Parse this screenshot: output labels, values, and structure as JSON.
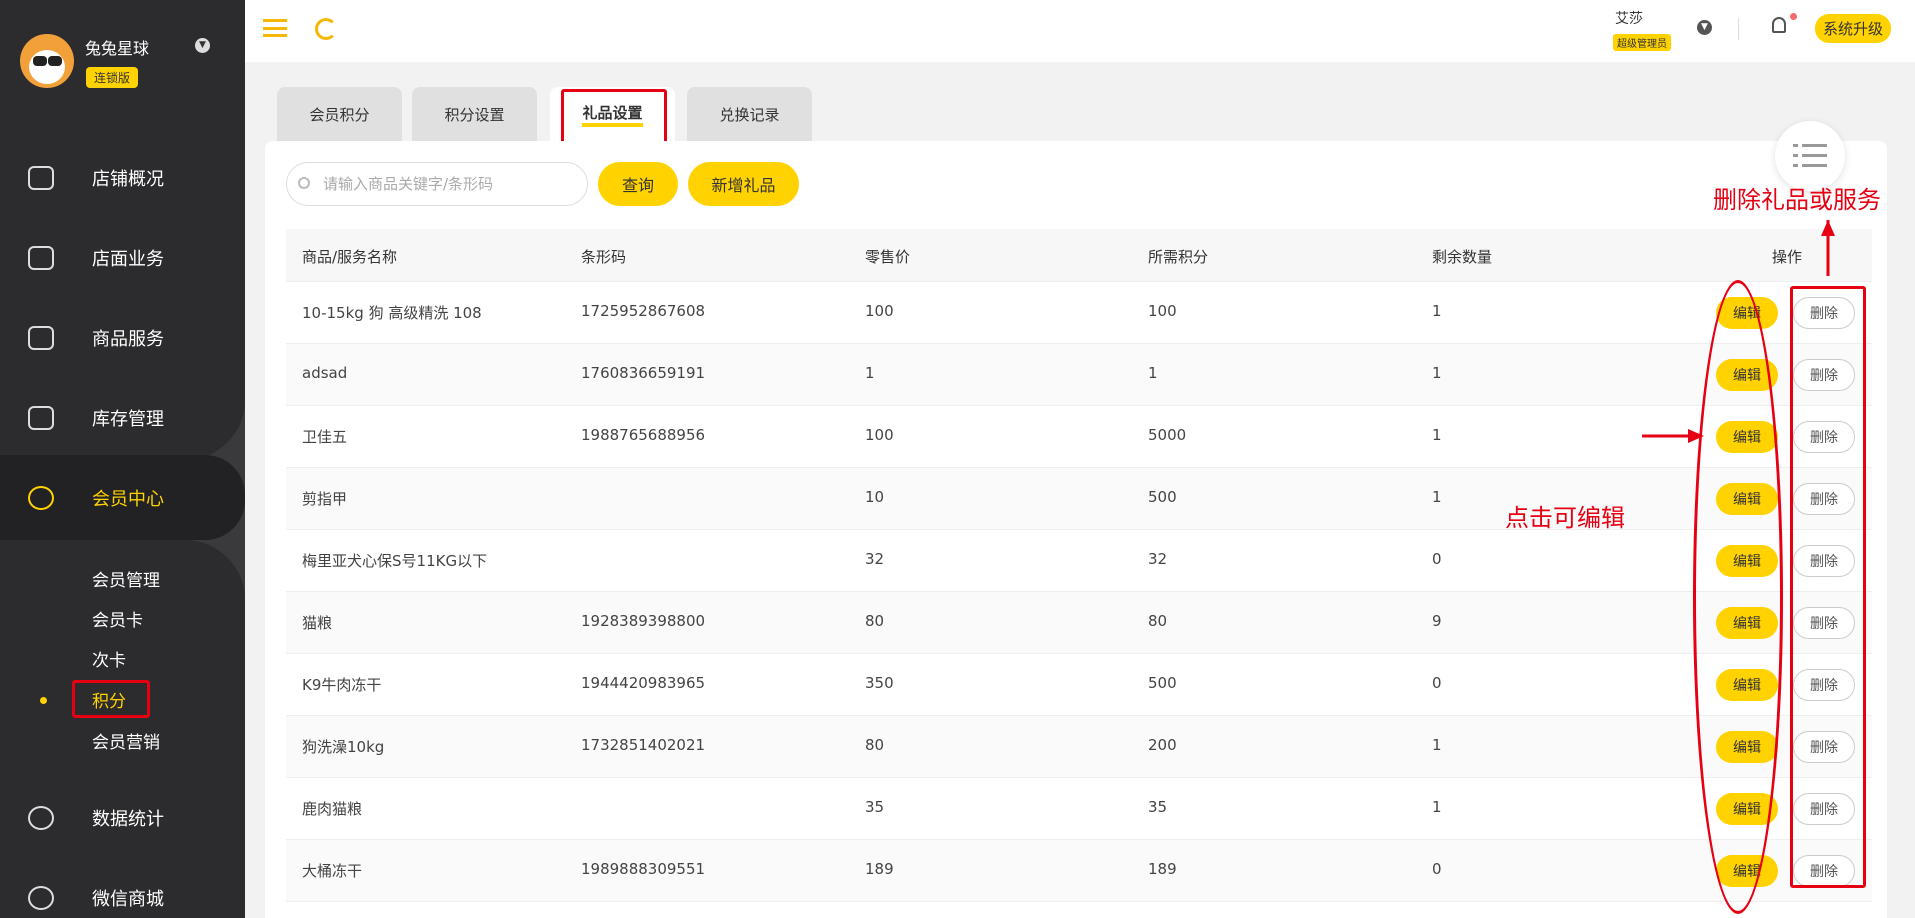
{
  "sidebar": {
    "shop_name": "兔兔星球",
    "edition": "连锁版",
    "nav": [
      {
        "label": "店铺概况",
        "icon": "monitor-icon"
      },
      {
        "label": "店面业务",
        "icon": "home-icon"
      },
      {
        "label": "商品服务",
        "icon": "bag-icon"
      },
      {
        "label": "库存管理",
        "icon": "box-icon"
      },
      {
        "label": "会员中心",
        "icon": "member-icon"
      },
      {
        "label": "数据统计",
        "icon": "chart-icon"
      },
      {
        "label": "微信商城",
        "icon": "wechat-icon"
      }
    ],
    "sub_items": [
      "会员管理",
      "会员卡",
      "次卡",
      "积分",
      "会员营销"
    ]
  },
  "header": {
    "user_name": "艾莎",
    "user_role": "超级管理员",
    "upgrade_label": "系统升级"
  },
  "tabs": [
    "会员积分",
    "积分设置",
    "礼品设置",
    "兑换记录"
  ],
  "toolbar": {
    "search_placeholder": "请输入商品关键字/条形码",
    "query_label": "查询",
    "add_label": "新增礼品"
  },
  "table": {
    "headers": [
      "商品/服务名称",
      "条形码",
      "零售价",
      "所需积分",
      "剩余数量",
      "操作"
    ],
    "rows": [
      {
        "name": "10-15kg 狗 高级精洗 108",
        "barcode": "1725952867608",
        "price": "100",
        "points": "100",
        "stock": "1"
      },
      {
        "name": "adsad",
        "barcode": "1760836659191",
        "price": "1",
        "points": "1",
        "stock": "1"
      },
      {
        "name": "卫佳五",
        "barcode": "1988765688956",
        "price": "100",
        "points": "5000",
        "stock": "1"
      },
      {
        "name": "剪指甲",
        "barcode": "",
        "price": "10",
        "points": "500",
        "stock": "1"
      },
      {
        "name": "梅里亚犬心保S号11KG以下",
        "barcode": "",
        "price": "32",
        "points": "32",
        "stock": "0"
      },
      {
        "name": "猫粮",
        "barcode": "1928389398800",
        "price": "80",
        "points": "80",
        "stock": "9"
      },
      {
        "name": "K9牛肉冻干",
        "barcode": "1944420983965",
        "price": "350",
        "points": "500",
        "stock": "0"
      },
      {
        "name": "狗洗澡10kg",
        "barcode": "1732851402021",
        "price": "80",
        "points": "200",
        "stock": "1"
      },
      {
        "name": "鹿肉猫粮",
        "barcode": "",
        "price": "35",
        "points": "35",
        "stock": "1"
      },
      {
        "name": "大桶冻干",
        "barcode": "1989888309551",
        "price": "189",
        "points": "189",
        "stock": "0"
      }
    ],
    "edit_label": "编辑",
    "delete_label": "删除"
  },
  "annotations": {
    "delete_note": "删除礼品或服务",
    "edit_note": "点击可编辑"
  },
  "colors": {
    "accent": "#ffd200",
    "sidebar": "#2c2c2e",
    "annotation": "#e60012"
  }
}
